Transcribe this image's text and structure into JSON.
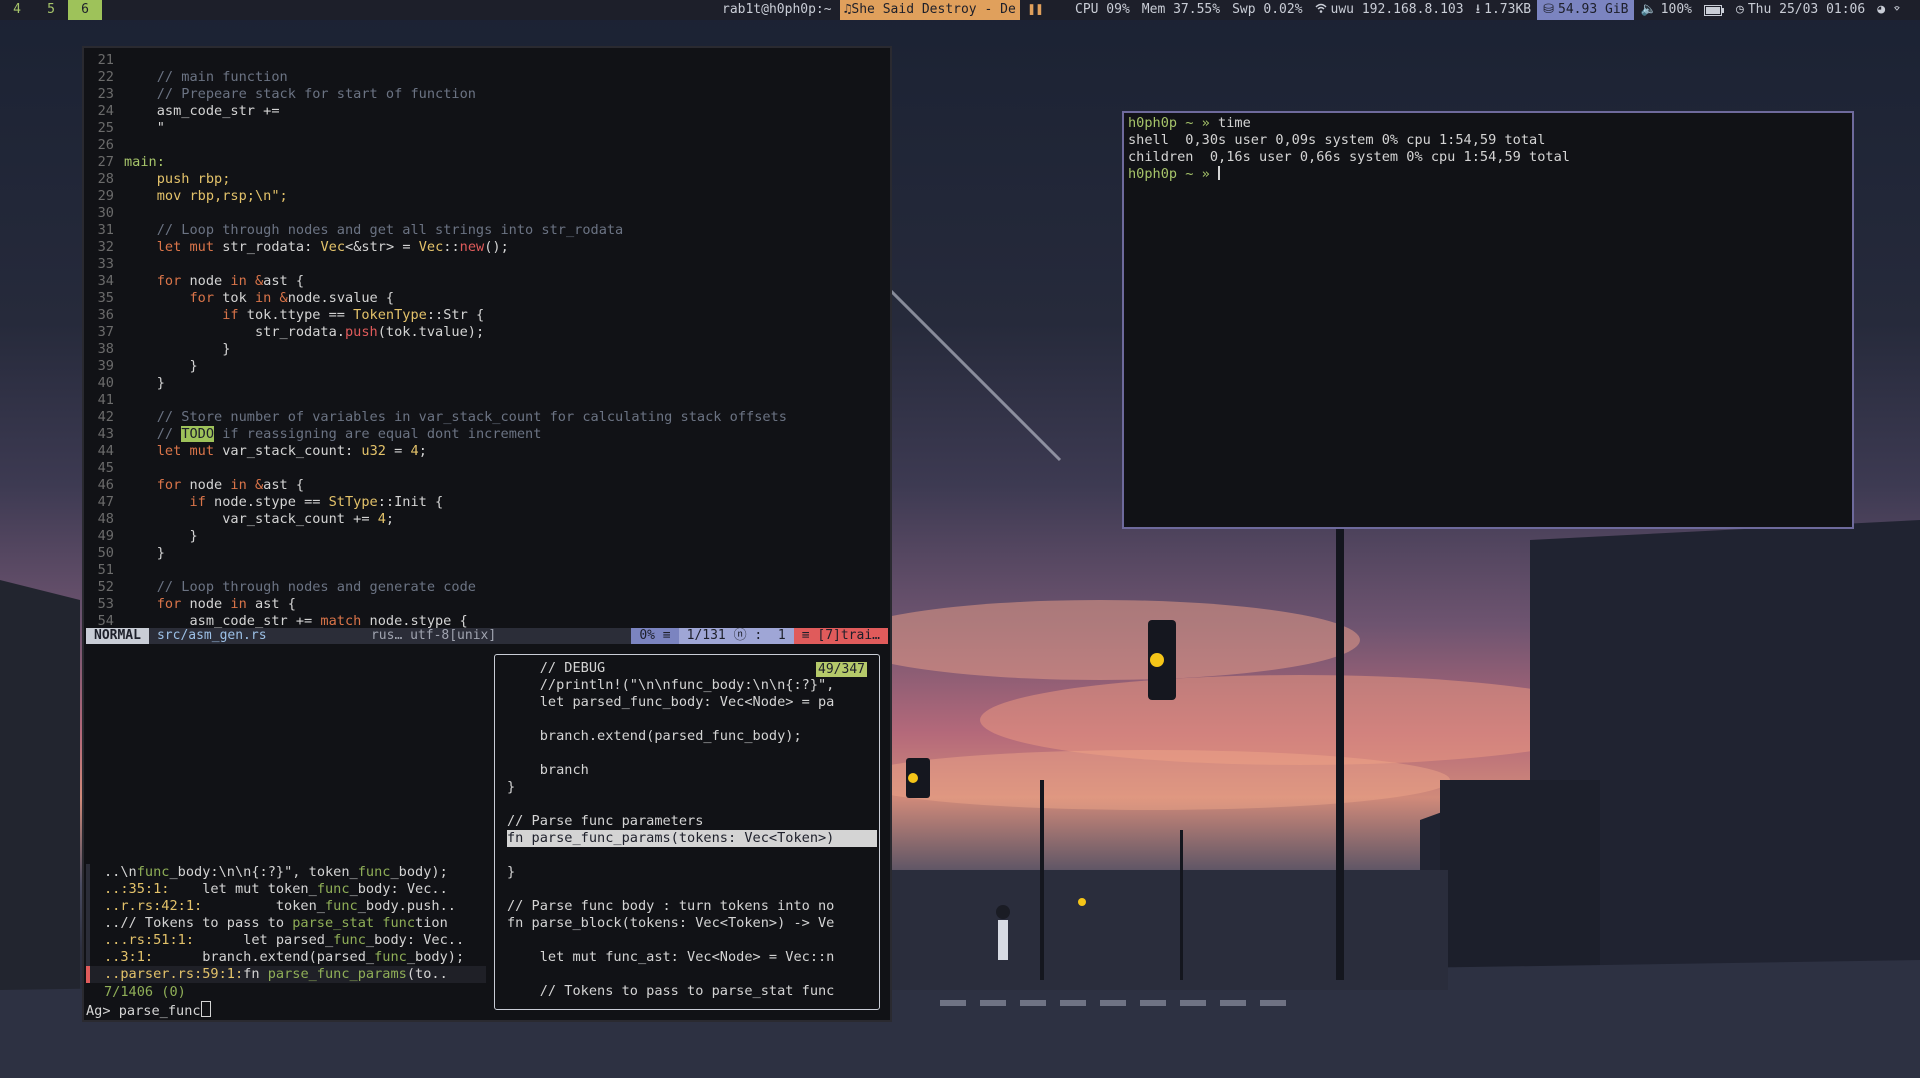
{
  "topbar": {
    "workspaces": [
      "4",
      "5",
      "6"
    ],
    "active_workspace": "6",
    "window_title": "rab1t@h0ph0p:~",
    "music": "She Said Destroy - De",
    "pause_icon": "pause-icon",
    "cpu": "CPU 09%",
    "mem": "Mem 37.55%",
    "swap": "Swp 0.02%",
    "network": "uwu 192.168.8.103",
    "download": "1.73KB",
    "disk": "54.93 GiB",
    "volume": "100%",
    "datetime": "Thu 25/03 01:06"
  },
  "vim": {
    "lines": [
      {
        "n": "21",
        "t": ""
      },
      {
        "n": "22",
        "t": "    // main function"
      },
      {
        "n": "23",
        "t": "    // Prepeare stack for start of function"
      },
      {
        "n": "24",
        "t": "    asm_code_str +="
      },
      {
        "n": "25",
        "t": "    \""
      },
      {
        "n": "26",
        "t": ""
      },
      {
        "n": "27",
        "t": "main:"
      },
      {
        "n": "28",
        "t": "    push rbp;"
      },
      {
        "n": "29",
        "t": "    mov rbp,rsp;\\n\";"
      },
      {
        "n": "30",
        "t": ""
      },
      {
        "n": "31",
        "t": "    // Loop through nodes and get all strings into str_rodata"
      },
      {
        "n": "32",
        "t": "    let mut str_rodata: Vec<&str> = Vec::new();"
      },
      {
        "n": "33",
        "t": ""
      },
      {
        "n": "34",
        "t": "    for node in &ast {"
      },
      {
        "n": "35",
        "t": "        for tok in &node.svalue {"
      },
      {
        "n": "36",
        "t": "            if tok.ttype == TokenType::Str {"
      },
      {
        "n": "37",
        "t": "                str_rodata.push(tok.tvalue);"
      },
      {
        "n": "38",
        "t": "            }"
      },
      {
        "n": "39",
        "t": "        }"
      },
      {
        "n": "40",
        "t": "    }"
      },
      {
        "n": "41",
        "t": ""
      },
      {
        "n": "42",
        "t": "    // Store number of variables in var_stack_count for calculating stack offsets"
      },
      {
        "n": "43",
        "t": "    // TODO if reassigning are equal dont increment"
      },
      {
        "n": "44",
        "t": "    let mut var_stack_count: u32 = 4;"
      },
      {
        "n": "45",
        "t": ""
      },
      {
        "n": "46",
        "t": "    for node in &ast {"
      },
      {
        "n": "47",
        "t": "        if node.stype == StType::Init {"
      },
      {
        "n": "48",
        "t": "            var_stack_count += 4;"
      },
      {
        "n": "49",
        "t": "        }"
      },
      {
        "n": "50",
        "t": "    }"
      },
      {
        "n": "51",
        "t": ""
      },
      {
        "n": "52",
        "t": "    // Loop through nodes and generate code"
      },
      {
        "n": "53",
        "t": "    for node in ast {"
      },
      {
        "n": "54",
        "t": "        asm_code_str += match node.stype {"
      }
    ],
    "status": {
      "mode": "NORMAL",
      "file": "src/asm_gen.rs",
      "filetype": "rus… utf-8[unix]",
      "percent": "0% ≡",
      "position": "1/131 ⓝ :  1",
      "warnings": "≡ [7]trai…"
    }
  },
  "fzf": {
    "results": [
      "..\\nfunc_body:\\n\\n{:?}\", token_func_body);",
      "..:35:1:    let mut token_func_body: Vec..",
      "..r.rs:42:1:         token_func_body.push..",
      "..// Tokens to pass to parse_stat function",
      "...rs:51:1:      let parsed_func_body: Vec..",
      "..3:1:      branch.extend(parsed_func_body);",
      "..parser.rs:59:1:fn parse_func_params(to.."
    ],
    "count": "7/1406 (0)",
    "prompt_label": "Ag>",
    "query": "parse_func",
    "preview_count": "49/347",
    "preview": [
      "    // DEBUG",
      "    //println!(\"\\n\\nfunc_body:\\n\\n{:?}\",",
      "    let parsed_func_body: Vec<Node> = pa",
      "",
      "    branch.extend(parsed_func_body);",
      "",
      "    branch",
      "}",
      "",
      "// Parse func parameters",
      "fn parse_func_params(tokens: Vec<Token>)",
      "",
      "}",
      "",
      "// Parse func body : turn tokens into no",
      "fn parse_block(tokens: Vec<Token>) -> Ve",
      "",
      "    let mut func_ast: Vec<Node> = Vec::n",
      "",
      "    // Tokens to pass to parse_stat func"
    ]
  },
  "terminal": {
    "lines": [
      {
        "prompt": "h0ph0p ~ »",
        "text": " time"
      },
      {
        "prompt": "",
        "text": "shell  0,30s user 0,09s system 0% cpu 1:54,59 total"
      },
      {
        "prompt": "",
        "text": "children  0,16s user 0,66s system 0% cpu 1:54,59 total"
      },
      {
        "prompt": "h0ph0p ~ »",
        "text": " "
      }
    ]
  }
}
